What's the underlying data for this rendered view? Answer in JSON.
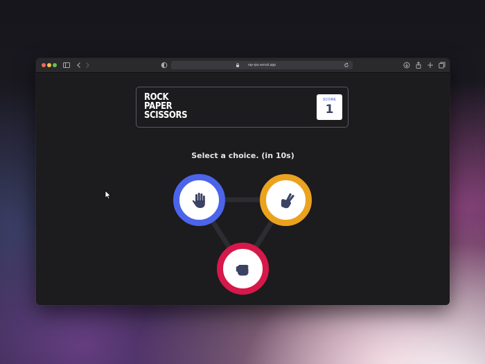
{
  "browser": {
    "url": "rsp-rps.vercel.app"
  },
  "game": {
    "title_lines": [
      "ROCK",
      "PAPER",
      "SCISSORS"
    ],
    "score_label": "SCORE",
    "score_value": "1",
    "prompt": "Select a choice. (in 10s)"
  },
  "choices": [
    {
      "name": "paper",
      "icon": "open-hand-icon",
      "ring_color": "#4c64ea"
    },
    {
      "name": "scissors",
      "icon": "peace-hand-icon",
      "ring_color": "#eaa21f"
    },
    {
      "name": "rock",
      "icon": "fist-icon",
      "ring_color": "#d6184a"
    }
  ],
  "colors": {
    "icon": "#3b4364",
    "page_background": "#1c1b1d",
    "score_label": "#2a46c4"
  }
}
